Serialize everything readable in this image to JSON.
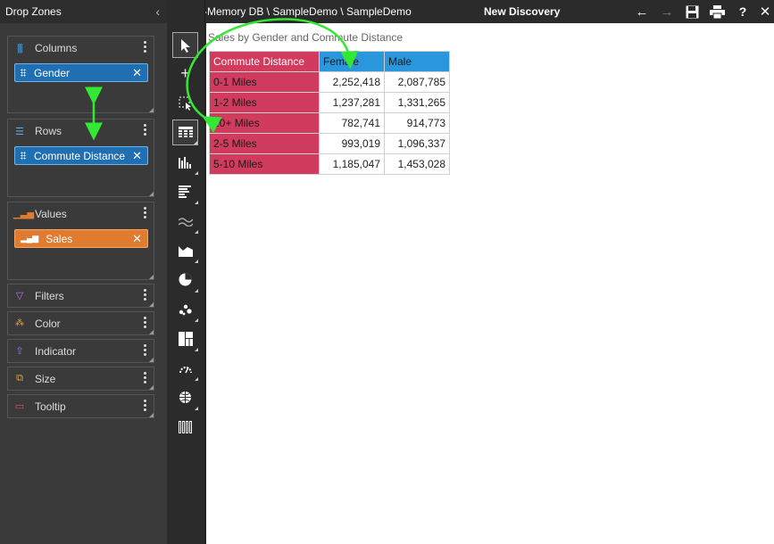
{
  "drop_zones": {
    "title": "Drop Zones",
    "columns": {
      "label": "Columns",
      "pill": "Gender"
    },
    "rows": {
      "label": "Rows",
      "pill": "Commute Distance"
    },
    "values": {
      "label": "Values",
      "pill": "Sales"
    },
    "filters": "Filters",
    "color": "Color",
    "indicator": "Indicator",
    "size": "Size",
    "tooltip": "Tooltip"
  },
  "topbar": {
    "breadcrumb": "In-Memory DB \\ SampleDemo \\ SampleDemo",
    "title": "New Discovery"
  },
  "grid": {
    "title": "Sales by Gender and Commute Distance",
    "row_header": "Commute Distance",
    "col_headers": [
      "Female",
      "Male"
    ],
    "rows": [
      {
        "label": "0-1 Miles",
        "values": [
          "2,252,418",
          "2,087,785"
        ]
      },
      {
        "label": "1-2 Miles",
        "values": [
          "1,237,281",
          "1,331,265"
        ]
      },
      {
        "label": "10+ Miles",
        "values": [
          "782,741",
          "914,773"
        ]
      },
      {
        "label": "2-5 Miles",
        "values": [
          "993,019",
          "1,096,337"
        ]
      },
      {
        "label": "5-10 Miles",
        "values": [
          "1,185,047",
          "1,453,028"
        ]
      }
    ]
  },
  "colors": {
    "row_header": "#d13b5e",
    "col_header": "#2a96dc",
    "pill_blue": "#1f6fb2",
    "pill_orange": "#e07b30",
    "annotation": "#33e833"
  }
}
